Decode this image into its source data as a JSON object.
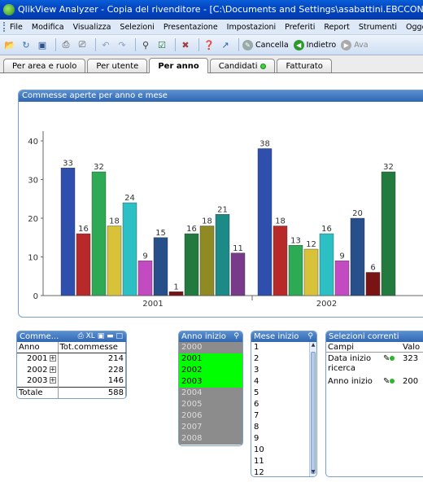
{
  "window": {
    "title": "QlikView Analyzer - Copia del rivenditore - [C:\\Documents and Settings\\asabattini.EBCCONSUL"
  },
  "menu": [
    "File",
    "Modifica",
    "Visualizza",
    "Selezioni",
    "Presentazione",
    "Impostazioni",
    "Preferiti",
    "Report",
    "Strumenti",
    "Oggetto"
  ],
  "toolbar": {
    "cancella": "Cancella",
    "indietro": "Indietro",
    "avanti": "Ava"
  },
  "tabs": [
    "Per area e ruolo",
    "Per utente",
    "Per anno",
    "Candidati",
    "Fatturato"
  ],
  "active_tab": "Per anno",
  "chart_data": {
    "type": "bar",
    "title": "Commesse aperte per anno e mese",
    "groups": [
      "2001",
      "2002"
    ],
    "series": [
      {
        "group": "2001",
        "values": [
          33,
          16,
          32,
          18,
          24,
          9,
          15,
          1,
          16,
          18,
          21,
          11
        ]
      },
      {
        "group": "2002",
        "values": [
          38,
          18,
          13,
          12,
          16,
          9,
          20,
          6,
          32
        ]
      }
    ],
    "colors": [
      "#2f4fae",
      "#b82a2a",
      "#2eaa55",
      "#d7c23a",
      "#2cc0c4",
      "#c24bc2",
      "#274f8a",
      "#7a1414",
      "#237a3e",
      "#8f8a24",
      "#1c8a86",
      "#7a3a8a"
    ],
    "yticks": [
      "0",
      "10",
      "20",
      "30",
      "40"
    ],
    "ylim": [
      0,
      40
    ]
  },
  "table": {
    "title": "Comme...",
    "header_icons": "XL",
    "columns": [
      "Anno",
      "Tot.commesse"
    ],
    "rows": [
      {
        "anno": "2001",
        "value": "214"
      },
      {
        "anno": "2002",
        "value": "228"
      },
      {
        "anno": "2003",
        "value": "146"
      }
    ],
    "total_label": "Totale",
    "total_value": "588"
  },
  "anno_inizio": {
    "title": "Anno inizio",
    "items": [
      {
        "label": "2000",
        "state": "excl"
      },
      {
        "label": "2001",
        "state": "sel"
      },
      {
        "label": "2002",
        "state": "sel"
      },
      {
        "label": "2003",
        "state": "sel"
      },
      {
        "label": "2004",
        "state": "excl"
      },
      {
        "label": "2005",
        "state": "excl"
      },
      {
        "label": "2006",
        "state": "excl"
      },
      {
        "label": "2007",
        "state": "excl"
      },
      {
        "label": "2008",
        "state": "excl"
      }
    ]
  },
  "mese_inizio": {
    "title": "Mese inizio",
    "items": [
      "1",
      "2",
      "3",
      "4",
      "5",
      "6",
      "7",
      "8",
      "9",
      "10",
      "11",
      "12"
    ]
  },
  "selezioni": {
    "title": "Selezioni correnti",
    "col_campi": "Campi",
    "col_valori": "Valo",
    "rows": [
      {
        "campo": "Data inizio ricerca",
        "valore": "323"
      },
      {
        "campo": "Anno inizio",
        "valore": "200"
      }
    ]
  }
}
